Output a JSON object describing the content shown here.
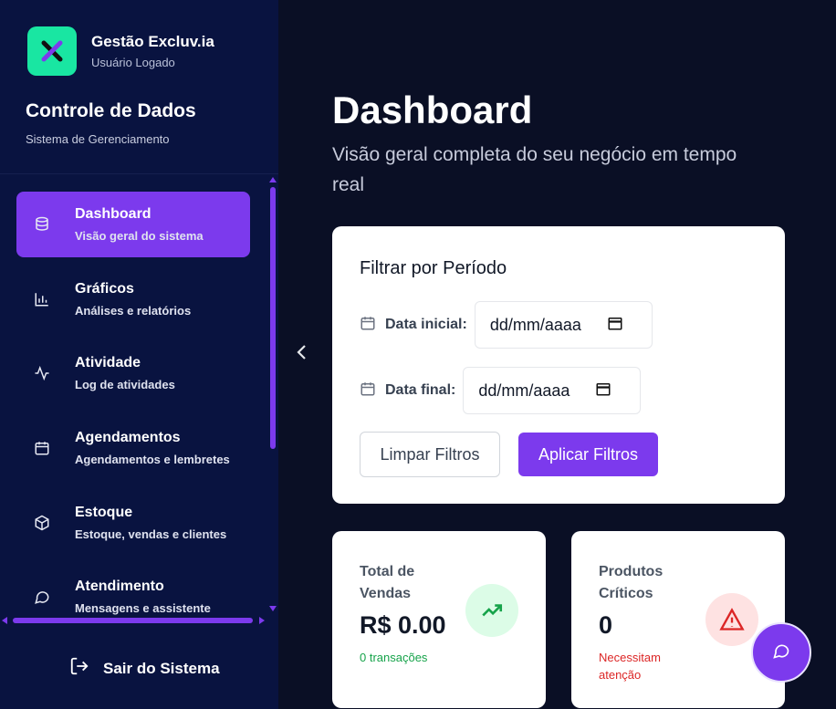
{
  "brand": {
    "name": "Gestão Excluv.ia",
    "user": "Usuário Logado",
    "logo_icon": "x-logo-icon",
    "accent": "#19e6a2"
  },
  "sidebar": {
    "title": "Controle de Dados",
    "subtitle": "Sistema de Gerenciamento",
    "items": [
      {
        "label": "Dashboard",
        "desc": "Visão geral do sistema",
        "icon": "database-icon",
        "active": true
      },
      {
        "label": "Gráficos",
        "desc": "Análises e relatórios",
        "icon": "bar-chart-icon",
        "active": false
      },
      {
        "label": "Atividade",
        "desc": "Log de atividades",
        "icon": "activity-icon",
        "active": false
      },
      {
        "label": "Agendamentos",
        "desc": "Agendamentos e lembretes",
        "icon": "calendar-icon",
        "active": false
      },
      {
        "label": "Estoque",
        "desc": "Estoque, vendas e clientes",
        "icon": "package-icon",
        "active": false
      },
      {
        "label": "Atendimento",
        "desc": "Mensagens e assistente",
        "icon": "message-icon",
        "active": false
      }
    ],
    "logout_label": "Sair do Sistema"
  },
  "header": {
    "title": "Dashboard",
    "subtitle": "Visão geral completa do seu negócio em tempo real"
  },
  "filters": {
    "title": "Filtrar por Período",
    "start_label": "Data inicial:",
    "start_placeholder": "dd/mm/aaaa",
    "end_label": "Data final:",
    "end_placeholder": "dd/mm/aaaa",
    "clear_label": "Limpar Filtros",
    "apply_label": "Aplicar Filtros"
  },
  "stats": [
    {
      "label": "Total de Vendas",
      "value": "R$ 0.00",
      "note": "0 transações",
      "note_color": "#16a34a",
      "icon": "trending-up-icon",
      "icon_bg": "#dcfce7",
      "icon_color": "#16a34a"
    },
    {
      "label": "Produtos Críticos",
      "value": "0",
      "note": "Necessitam atenção",
      "note_color": "#dc2626",
      "icon": "alert-triangle-icon",
      "icon_bg": "#fee2e2",
      "icon_color": "#dc2626"
    }
  ],
  "colors": {
    "primary": "#7c3aed",
    "sidebar_bg": "#091340",
    "page_bg": "#0a0f25"
  }
}
